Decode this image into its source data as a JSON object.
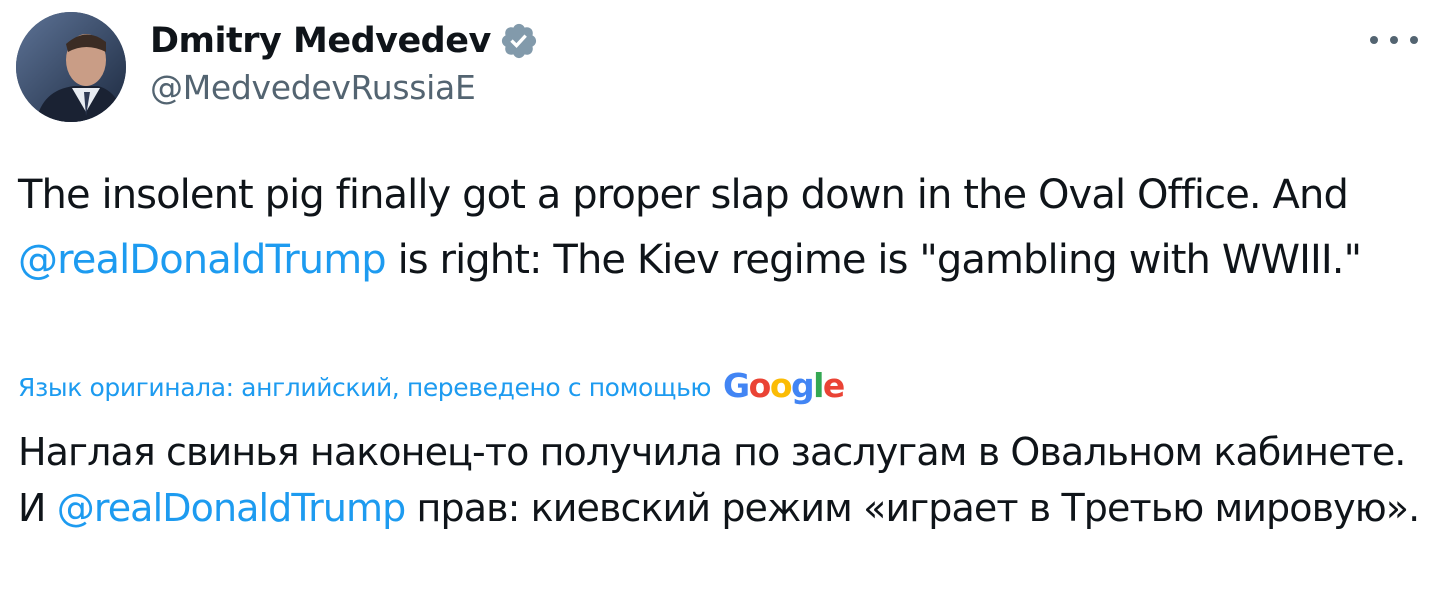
{
  "author": {
    "display_name": "Dmitry Medvedev",
    "handle": "@MedvedevRussiaE",
    "verified": true,
    "avatar_icon": "profile-photo"
  },
  "menu": {
    "more_icon": "more-horizontal-icon"
  },
  "tweet": {
    "text_part1": "The insolent pig finally got a proper slap down in the Oval Office. And ",
    "mention": "@realDonaldTrump",
    "text_part2": " is right: The Kiev regime is \"gambling with WWIII.\""
  },
  "translation": {
    "note": "Язык оригинала: английский, переведено с помощью",
    "provider_logo": {
      "letters": [
        "G",
        "o",
        "o",
        "g",
        "l",
        "e"
      ],
      "colors": [
        "#4285f4",
        "#ea4335",
        "#fbbc05",
        "#4285f4",
        "#34a853",
        "#ea4335"
      ]
    },
    "text_part1": "Наглая свинья наконец-то получила по заслугам в Овальном кабинете. И ",
    "mention": "@realDonaldTrump",
    "text_part2": " прав: киевский режим «играет в Третью мировую»."
  },
  "colors": {
    "text": "#0f1419",
    "secondary": "#536471",
    "link": "#1d9bf0",
    "verified_badge": "#829aab"
  }
}
